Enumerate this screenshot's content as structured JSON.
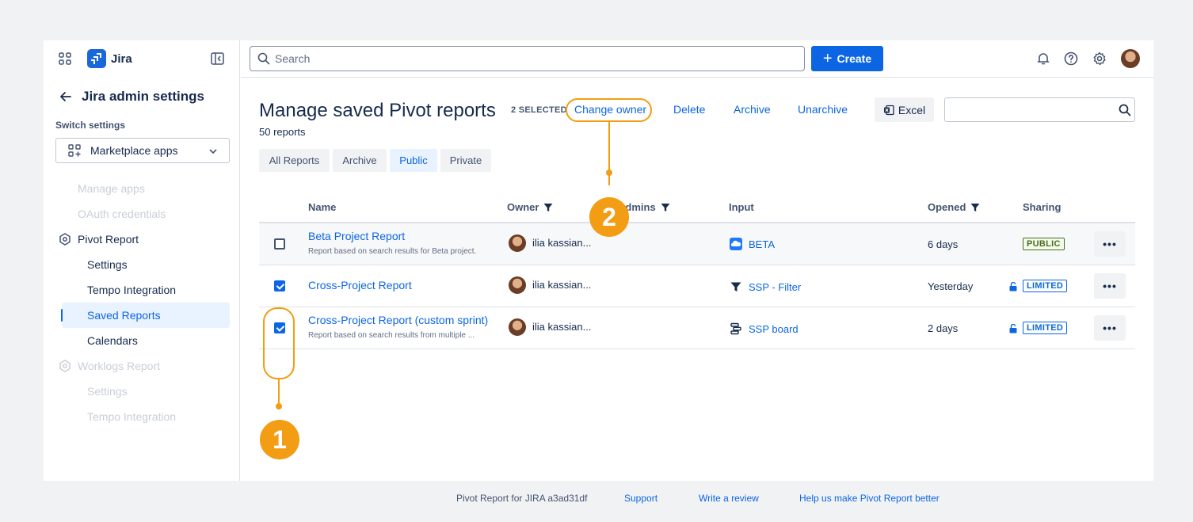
{
  "sidebar": {
    "app_name": "Jira",
    "back_title": "Jira admin settings",
    "switch_label": "Switch settings",
    "switch_value": "Marketplace apps",
    "items": {
      "manage_apps": "Manage apps",
      "oauth": "OAuth credentials",
      "pivot_report": "Pivot Report",
      "settings": "Settings",
      "tempo": "Tempo Integration",
      "saved_reports": "Saved Reports",
      "calendars": "Calendars",
      "worklogs_report": "Worklogs Report",
      "settings2": "Settings",
      "tempo2": "Tempo Integration"
    }
  },
  "topbar": {
    "search_placeholder": "Search",
    "create_label": "Create"
  },
  "page": {
    "title": "Manage saved Pivot reports",
    "selected_count": "2 SELECTED",
    "report_count": "50 reports",
    "actions": {
      "change_owner": "Change owner",
      "delete": "Delete",
      "archive": "Archive",
      "unarchive": "Unarchive",
      "excel": "Excel"
    },
    "tabs": [
      "All Reports",
      "Archive",
      "Public",
      "Private"
    ],
    "active_tab": "Public"
  },
  "table": {
    "headers": {
      "name": "Name",
      "owner": "Owner",
      "admins": "Admins",
      "input": "Input",
      "opened": "Opened",
      "sharing": "Sharing"
    },
    "rows": [
      {
        "name": "Beta Project Report",
        "description": "Report based on search results for Beta project.",
        "owner": "ilia kassian...",
        "input": "BETA",
        "input_icon": "project-icon",
        "opened": "6 days",
        "sharing": "PUBLIC",
        "checked": false
      },
      {
        "name": "Cross-Project Report",
        "description": "",
        "owner": "ilia kassian...",
        "input": "SSP - Filter",
        "input_icon": "filter-icon",
        "opened": "Yesterday",
        "sharing": "LIMITED",
        "checked": true
      },
      {
        "name": "Cross-Project Report (custom sprint)",
        "description": "Report based on search results from multiple ...",
        "owner": "ilia kassian...",
        "input": "SSP board",
        "input_icon": "board-icon",
        "opened": "2 days",
        "sharing": "LIMITED",
        "checked": true
      }
    ],
    "more_label": "•••"
  },
  "annotations": {
    "marker_1": "1",
    "marker_2": "2"
  },
  "footer": {
    "version": "Pivot Report for JIRA a3ad31df",
    "support": "Support",
    "review": "Write a review",
    "improve": "Help us make Pivot Report better"
  },
  "colors": {
    "accent": "#0c66e4",
    "annotation": "#f29d13",
    "public_badge": "#4c6b1f"
  }
}
